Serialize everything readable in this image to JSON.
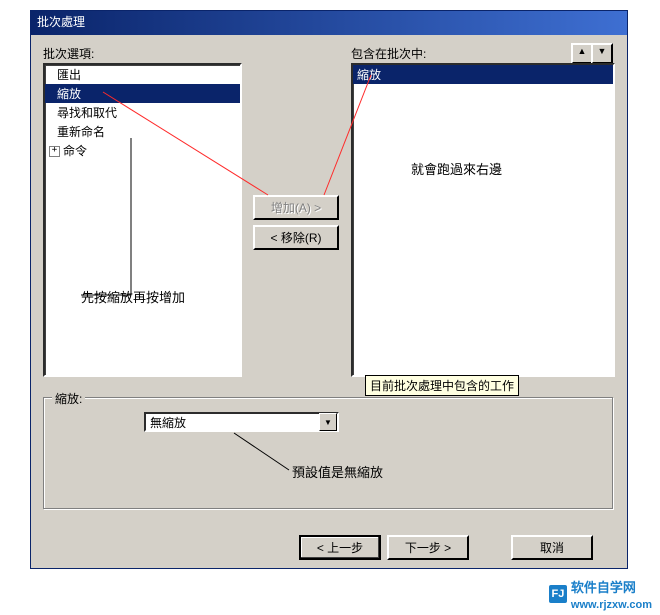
{
  "window": {
    "title": "批次處理"
  },
  "labels": {
    "batch_options": "批次選項:",
    "included": "包含在批次中:"
  },
  "options_list": {
    "items": [
      {
        "label": "匯出",
        "selected": false
      },
      {
        "label": "縮放",
        "selected": true
      },
      {
        "label": "尋找和取代",
        "selected": false
      },
      {
        "label": "重新命名",
        "selected": false
      }
    ],
    "tree_item": "命令"
  },
  "included_list": {
    "items": [
      {
        "label": "縮放",
        "selected": true
      }
    ]
  },
  "buttons": {
    "add": "增加(A) >",
    "remove": "< 移除(R)",
    "back": "< 上一步",
    "next": "下一步 >",
    "cancel": "取消"
  },
  "group": {
    "title": "縮放:"
  },
  "combo": {
    "value": "無縮放"
  },
  "tooltip": "目前批次處理中包含的工作",
  "annotations": {
    "left": "先按縮放再按增加",
    "right": "就會跑過來右邊",
    "bottom": "預設值是無縮放"
  },
  "watermark": {
    "brand": "软件自学网",
    "url": "www.rjzxw.com"
  }
}
